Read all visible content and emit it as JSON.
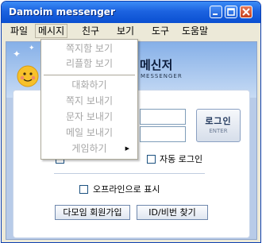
{
  "window": {
    "title": "Damoim messenger"
  },
  "menu": {
    "items": [
      "파일",
      "메시지",
      "친구",
      "보기",
      "도구",
      "도움말"
    ]
  },
  "message_menu": {
    "items": [
      "쪽지함 보기",
      "리플함 보기",
      "대화하기",
      "쪽지 보내기",
      "문자 보내기",
      "메일 보내기",
      "게임하기"
    ],
    "submenu_arrow": "▶"
  },
  "brand": {
    "korean": "메신저",
    "english": "MESSENGER"
  },
  "login": {
    "button_label": "로그인",
    "button_sub": "ENTER",
    "id_value": "",
    "password_value": ""
  },
  "options": {
    "auto_login": "자동 로그인",
    "offline_display": "오프라인으로 표시"
  },
  "buttons": {
    "join": "다모임 회원가입",
    "find_id": "ID/비번 찾기"
  },
  "colors": {
    "title_bar": "#1c63e0",
    "panel_bg": "#b8cbe8"
  }
}
